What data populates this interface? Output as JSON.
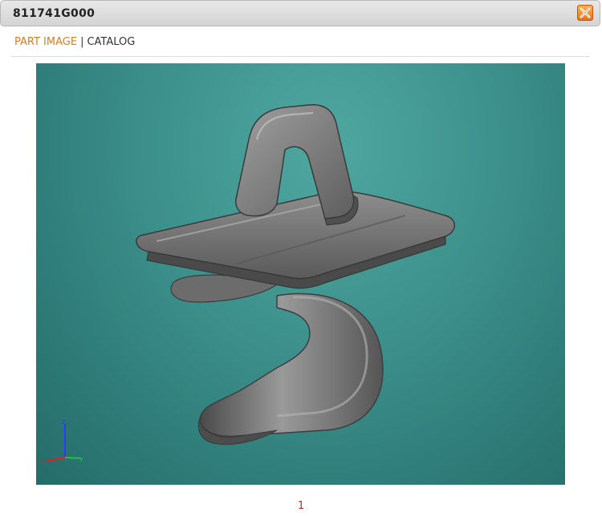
{
  "window": {
    "title": "811741G000",
    "close_icon": "close-icon"
  },
  "tabs": [
    {
      "label": "PART IMAGE",
      "active": true
    },
    {
      "label": "CATALOG",
      "active": false
    }
  ],
  "tab_separator": "|",
  "viewer": {
    "content": "part-3d-render",
    "axis_icon": "xyz-axis-triad-icon"
  },
  "pagination": {
    "current_page": "1"
  },
  "colors": {
    "accent": "#e07b1f",
    "page_number": "#cc2222",
    "viewport_bg": "#3e928d"
  }
}
